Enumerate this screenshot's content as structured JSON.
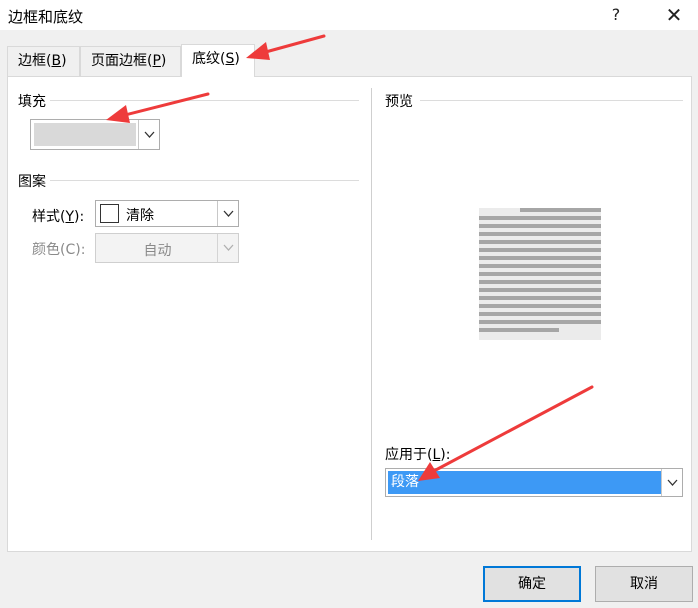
{
  "window": {
    "title": "边框和底纹",
    "help_glyph": "?",
    "close_glyph": "✕"
  },
  "tabs": [
    {
      "prefix": "边框(",
      "key": "B",
      "suffix": ")"
    },
    {
      "prefix": "页面边框(",
      "key": "P",
      "suffix": ")"
    },
    {
      "prefix": "底纹(",
      "key": "S",
      "suffix": ")"
    }
  ],
  "fill": {
    "label": "填充",
    "color": "#d9d9d9"
  },
  "pattern": {
    "label": "图案",
    "style_label_prefix": "样式(",
    "style_label_key": "Y",
    "style_label_suffix": "):",
    "style_value": "清除",
    "color_label": "颜色(C):",
    "color_value": "自动"
  },
  "preview": {
    "label": "预览"
  },
  "apply_to": {
    "label_prefix": "应用于(",
    "label_key": "L",
    "label_suffix": "):",
    "value": "段落",
    "highlight_color": "#3d99f5"
  },
  "buttons": {
    "ok": "确定",
    "cancel": "取消"
  },
  "icons": {
    "dropdown": "chevron-down-icon",
    "help": "help-icon",
    "close": "close-icon"
  },
  "annotation_color": "#ee3b3b"
}
